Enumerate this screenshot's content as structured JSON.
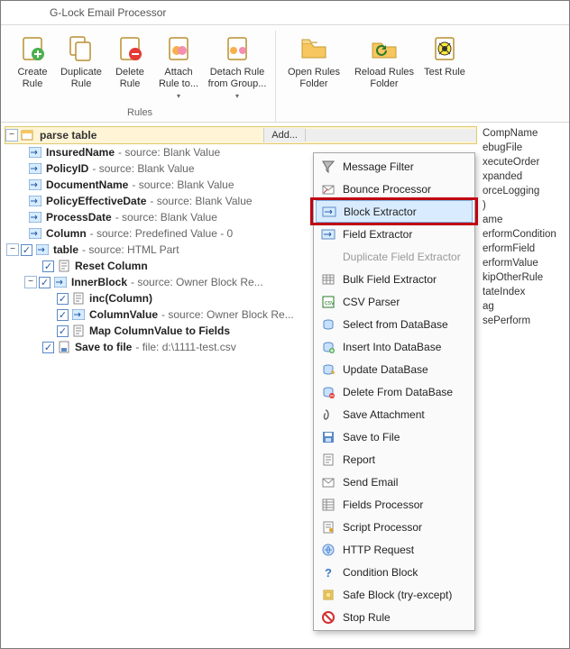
{
  "title": "G-Lock Email Processor",
  "ribbon": {
    "group_label": "Rules",
    "buttons": {
      "create": "Create Rule",
      "duplicate": "Duplicate Rule",
      "delete": "Delete Rule",
      "attach": "Attach Rule to...",
      "detach": "Detach Rule from Group...",
      "open_folder": "Open Rules Folder",
      "reload": "Reload Rules Folder",
      "test": "Test Rule"
    }
  },
  "tree": {
    "root": "parse table",
    "add_label": "Add...",
    "nodes": {
      "insured": {
        "name": "InsuredName",
        "meta": " - source: Blank Value"
      },
      "policyid": {
        "name": "PolicyID",
        "meta": " - source: Blank Value"
      },
      "docname": {
        "name": "DocumentName",
        "meta": " - source: Blank Value"
      },
      "peff": {
        "name": "PolicyEffectiveDate",
        "meta": " - source: Blank Value"
      },
      "pdate": {
        "name": "ProcessDate",
        "meta": " - source: Blank Value"
      },
      "column": {
        "name": "Column",
        "meta": " - source: Predefined Value - 0"
      },
      "table": {
        "name": "table",
        "meta": " - source: HTML Part"
      },
      "reset": {
        "name": "Reset Column",
        "meta": ""
      },
      "inner": {
        "name": "InnerBlock",
        "meta": " - source: Owner Block Re..."
      },
      "inc": {
        "name": "inc(Column)",
        "meta": ""
      },
      "colval": {
        "name": "ColumnValue",
        "meta": " - source: Owner Block Re..."
      },
      "map": {
        "name": "Map ColumnValue to Fields",
        "meta": ""
      },
      "save": {
        "name": "Save to file",
        "meta": " - file: d:\\1111-test.csv"
      }
    }
  },
  "menu": {
    "items": [
      "Message Filter",
      "Bounce Processor",
      "Block Extractor",
      "Field Extractor",
      "Duplicate Field Extractor",
      "Bulk Field Extractor",
      "CSV Parser",
      "Select from DataBase",
      "Insert Into DataBase",
      "Update DataBase",
      "Delete From DataBase",
      "Save Attachment",
      "Save to File",
      "Report",
      "Send Email",
      "Fields Processor",
      "Script Processor",
      "HTTP Request",
      "Condition Block",
      "Safe Block (try-except)",
      "Stop Rule"
    ],
    "highlighted_index": 2,
    "disabled_index": 4
  },
  "side": [
    "CompName",
    "ebugFile",
    "xecuteOrder",
    "xpanded",
    "orceLogging",
    ")",
    "ame",
    "erformCondition",
    "erformField",
    "erformValue",
    "kipOtherRule",
    "tateIndex",
    "ag",
    "sePerform"
  ]
}
